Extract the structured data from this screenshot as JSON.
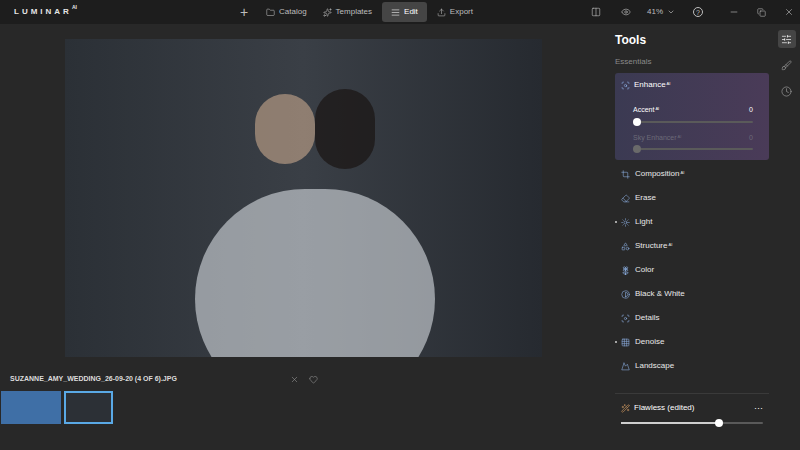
{
  "app": {
    "logo": "LUMINAR",
    "logo_suffix": "AI"
  },
  "top_bar": {
    "add": "+",
    "nav": [
      {
        "label": "Catalog",
        "kind": "catalog",
        "selected": false
      },
      {
        "label": "Templates",
        "kind": "templates",
        "selected": false
      },
      {
        "label": "Edit",
        "kind": "edit",
        "selected": true
      },
      {
        "label": "Export",
        "kind": "export",
        "selected": false
      }
    ],
    "zoom": "41%",
    "help": "?"
  },
  "image": {
    "filename": "SUZANNE_AMY_WEDDING_26-09-20 (4 OF 6).JPG",
    "favorite": false
  },
  "thumbnails": [
    {
      "selected": false,
      "color": "#3f6fa6"
    },
    {
      "selected": true,
      "color": "#2c3036"
    }
  ],
  "panel": {
    "title": "Tools",
    "section": "Essentials",
    "enhance": {
      "label": "Enhance",
      "badge": "AI",
      "expanded": true,
      "sliders": [
        {
          "label": "Accent",
          "badge": "AI",
          "value": "0",
          "level": 0,
          "disabled": false
        },
        {
          "label": "Sky Enhancer",
          "badge": "AI",
          "value": "0",
          "level": 0,
          "disabled": true
        }
      ]
    },
    "tools": [
      {
        "label": "Composition",
        "badge": "AI",
        "kind": "composition",
        "edited": false
      },
      {
        "label": "Erase",
        "badge": "",
        "kind": "erase",
        "edited": false
      },
      {
        "label": "Light",
        "badge": "",
        "kind": "light",
        "edited": true
      },
      {
        "label": "Structure",
        "badge": "AI",
        "kind": "structure",
        "edited": false
      },
      {
        "label": "Color",
        "badge": "",
        "kind": "color",
        "edited": false
      },
      {
        "label": "Black & White",
        "badge": "",
        "kind": "bw",
        "edited": false
      },
      {
        "label": "Details",
        "badge": "",
        "kind": "details",
        "edited": false
      },
      {
        "label": "Denoise",
        "badge": "",
        "kind": "denoise",
        "edited": true
      },
      {
        "label": "Landscape",
        "badge": "",
        "kind": "landscape",
        "edited": false
      }
    ],
    "preset": {
      "name": "Flawless (edited)",
      "menu": "···",
      "level": 0.7
    }
  },
  "side_tabs": [
    {
      "kind": "tools",
      "selected": true
    },
    {
      "kind": "brush",
      "selected": false
    },
    {
      "kind": "history",
      "selected": false
    }
  ]
}
